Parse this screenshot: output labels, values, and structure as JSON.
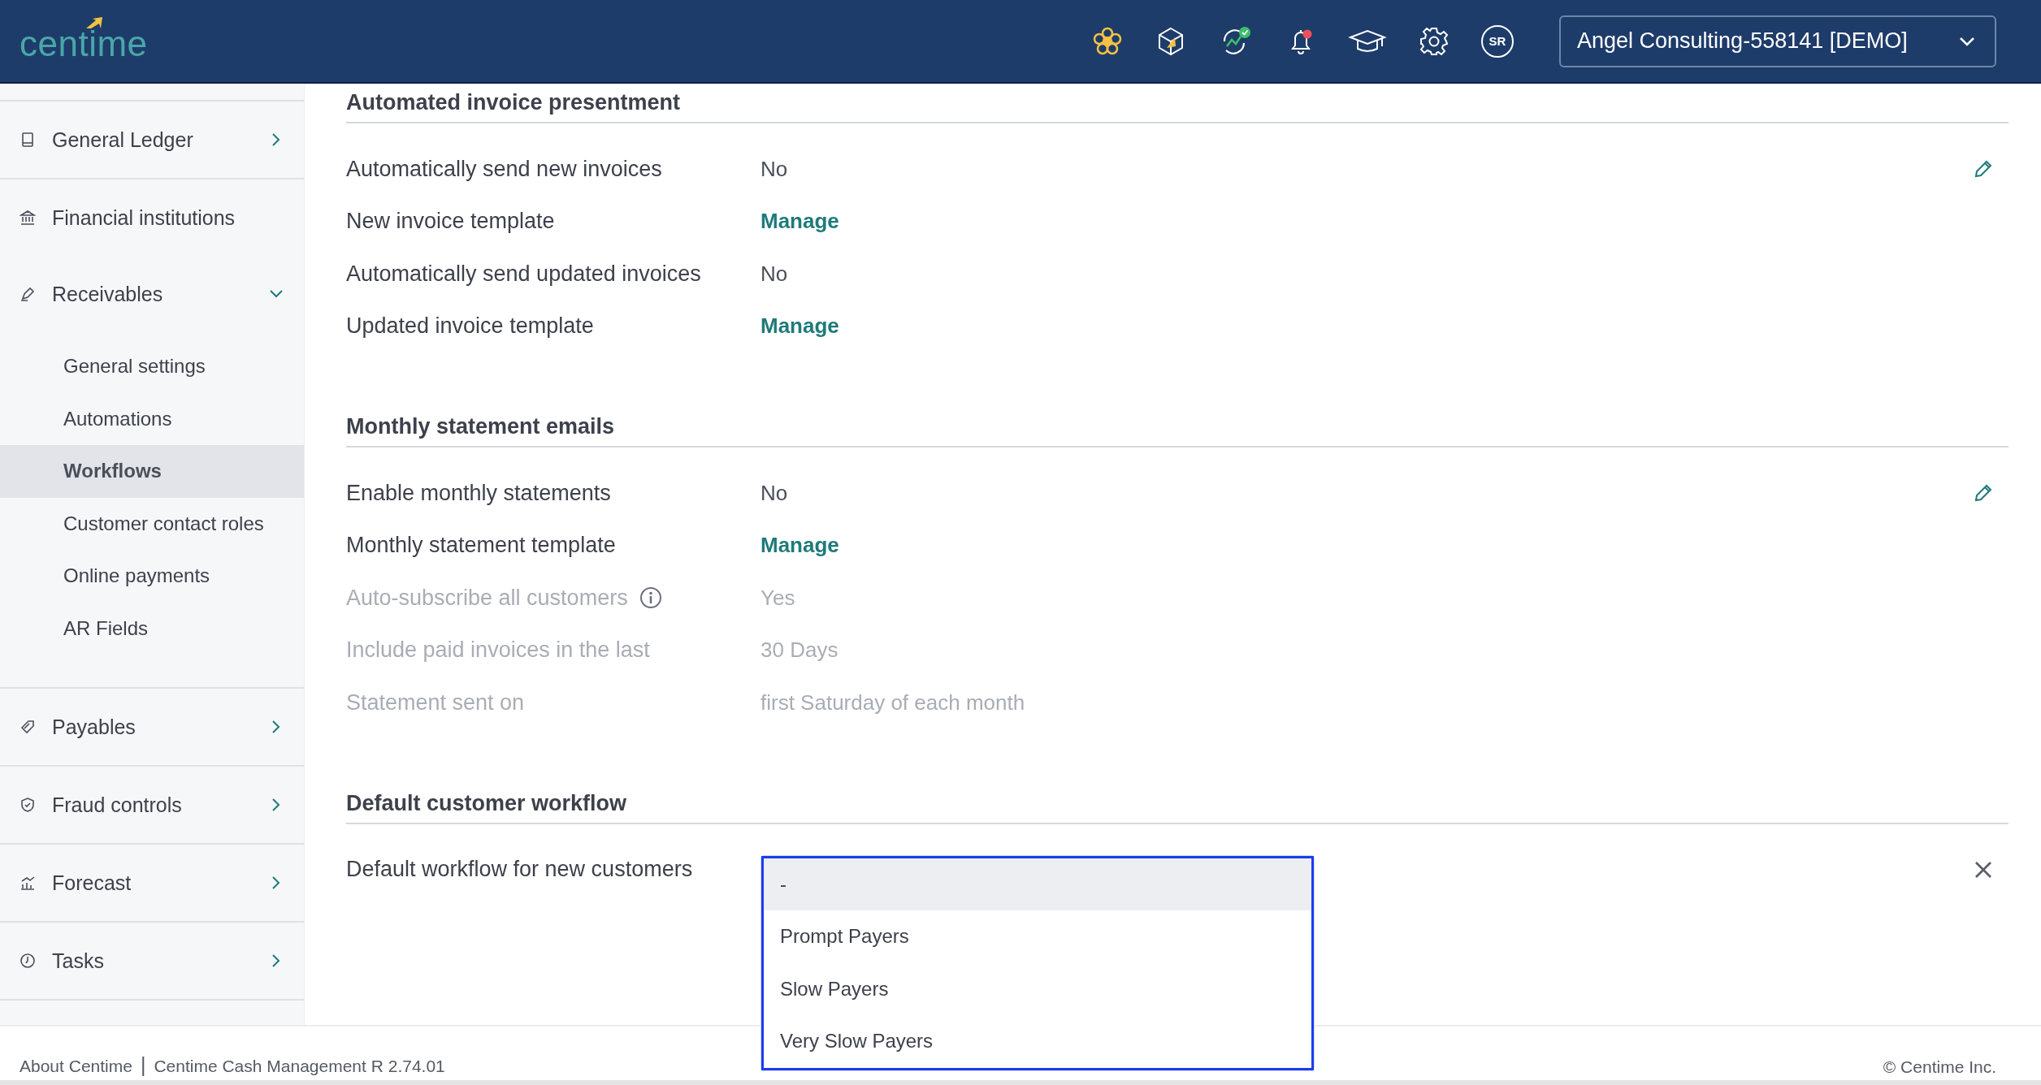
{
  "header": {
    "logo": "centime",
    "avatar": "SR",
    "notification": true,
    "company": "Angel Consulting-558141 [DEMO]"
  },
  "sidebar": {
    "items": [
      {
        "label": "General Ledger",
        "has_submenu": true,
        "expanded": false
      },
      {
        "label": "Financial institutions",
        "has_submenu": false
      },
      {
        "label": "Receivables",
        "has_submenu": true,
        "expanded": true,
        "children": [
          {
            "label": "General settings",
            "selected": false
          },
          {
            "label": "Automations",
            "selected": false
          },
          {
            "label": "Workflows",
            "selected": true
          },
          {
            "label": "Customer contact roles",
            "selected": false
          },
          {
            "label": "Online payments",
            "selected": false
          },
          {
            "label": "AR Fields",
            "selected": false
          }
        ]
      },
      {
        "label": "Payables",
        "has_submenu": true,
        "expanded": false
      },
      {
        "label": "Fraud controls",
        "has_submenu": true,
        "expanded": false
      },
      {
        "label": "Forecast",
        "has_submenu": true,
        "expanded": false
      },
      {
        "label": "Tasks",
        "has_submenu": true,
        "expanded": false
      }
    ]
  },
  "sections": [
    {
      "title": "Automated invoice presentment",
      "kind": "edit",
      "rows": [
        {
          "label": "Automatically send new invoices",
          "kind": "text",
          "value": "No",
          "disabled": false,
          "info": false
        },
        {
          "label": "New invoice template",
          "kind": "link",
          "value": "Manage",
          "disabled": false,
          "info": false
        },
        {
          "label": "Automatically send updated invoices",
          "kind": "text",
          "value": "No",
          "disabled": false,
          "info": false
        },
        {
          "label": "Updated invoice template",
          "kind": "link",
          "value": "Manage",
          "disabled": false,
          "info": false
        }
      ]
    },
    {
      "title": "Monthly statement emails",
      "kind": "edit",
      "rows": [
        {
          "label": "Enable monthly statements",
          "kind": "text",
          "value": "No",
          "disabled": false,
          "info": false
        },
        {
          "label": "Monthly statement template",
          "kind": "link",
          "value": "Manage",
          "disabled": false,
          "info": false
        },
        {
          "label": "Auto-subscribe all customers",
          "kind": "text",
          "value": "Yes",
          "disabled": true,
          "info": true
        },
        {
          "label": "Include paid invoices in the last",
          "kind": "text",
          "value": "30 Days",
          "disabled": true,
          "info": false
        },
        {
          "label": "Statement sent on",
          "kind": "text",
          "value": "first Saturday of each month",
          "disabled": true,
          "info": false
        }
      ]
    },
    {
      "title": "Default customer workflow",
      "kind": "close",
      "rows": [
        {
          "label": "Default workflow for new customers",
          "kind": "dropdown",
          "disabled": false,
          "info": false,
          "options": [
            {
              "label": "-",
              "selected": true
            },
            {
              "label": "Prompt Payers",
              "selected": false
            },
            {
              "label": "Slow Payers",
              "selected": false
            },
            {
              "label": "Very Slow Payers",
              "selected": false
            }
          ]
        }
      ]
    }
  ],
  "footer": {
    "about": "About Centime",
    "separator": "|",
    "version": "Centime Cash Management R 2.74.01",
    "copyright": "© Centime Inc."
  }
}
